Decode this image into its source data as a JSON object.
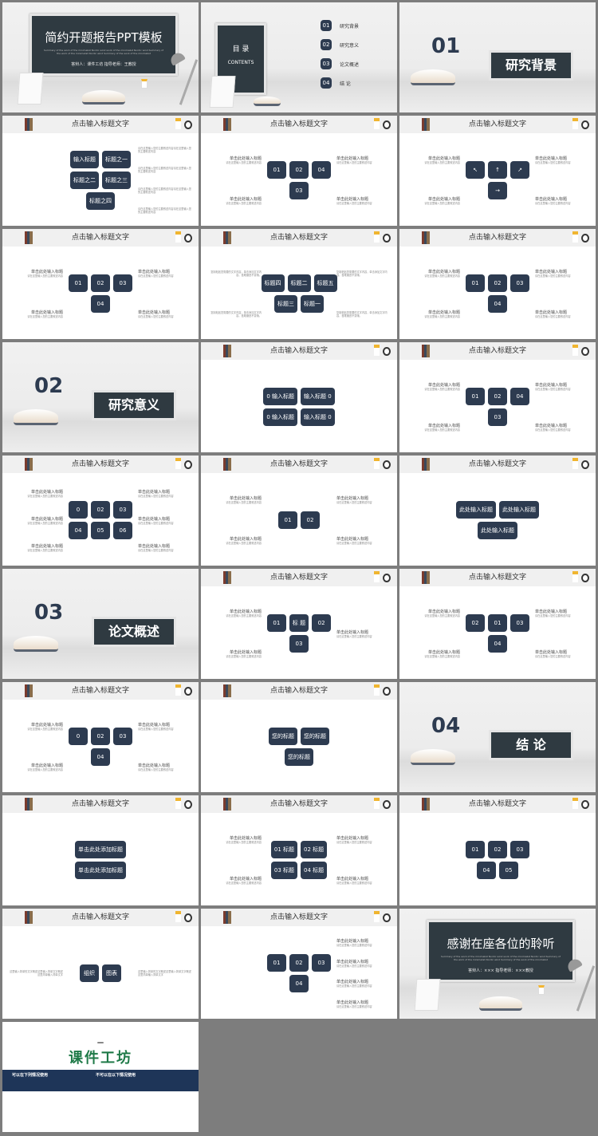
{
  "colors": {
    "navy": "#2d3b50",
    "chalkboard": "#2f3a41",
    "background": "#7d7d7d",
    "brand_green": "#1f7a48"
  },
  "slides": [
    {
      "type": "cover",
      "title": "简约开题报告PPT模板",
      "subtitle": "Summary of the work of the minimalist Nordic wind work of the minimalist Nordic wind Summary of the work of the minimalist Nordic wind Summary of the work of the minimalist",
      "presenter": "答辩人：课件工坊",
      "advisor": "指导老师：王教授"
    },
    {
      "type": "toc",
      "title": "目  录",
      "subtitle": "CONTENTS",
      "items": [
        {
          "num": "01",
          "label": "研究背景"
        },
        {
          "num": "02",
          "label": "研究意义"
        },
        {
          "num": "03",
          "label": "论文概述"
        },
        {
          "num": "04",
          "label": "结  论"
        }
      ]
    },
    {
      "type": "section",
      "num": "01",
      "title": "研究背景"
    },
    {
      "type": "content",
      "title": "点击输入标题文字",
      "shapes": [
        "输入标题",
        "标题之一",
        "标题之二",
        "标题之三",
        "标题之四"
      ],
      "left": [],
      "right": [
        {
          "h": "",
          "s": "请在这里输入您的主要叙述内容请在这里输入您的主要叙述内容"
        },
        {
          "h": "",
          "s": "请在这里输入您的主要叙述内容请在这里输入您的主要叙述内容"
        },
        {
          "h": "",
          "s": "请在这里输入您的主要叙述内容请在这里输入您的主要叙述内容"
        },
        {
          "h": "",
          "s": "请在这里输入您的主要叙述内容请在这里输入您的主要叙述内容"
        }
      ]
    },
    {
      "type": "content",
      "title": "点击输入标题文字",
      "shapes": [
        "01",
        "02",
        "04",
        "03"
      ],
      "left": [
        {
          "h": "单击此处输入标题",
          "s": "请在这里输入您的主要叙述内容"
        },
        {
          "h": "单击此处输入标题",
          "s": "请在这里输入您的主要叙述内容"
        }
      ],
      "right": [
        {
          "h": "单击此处输入标题",
          "s": "请在这里输入您的主要叙述内容"
        },
        {
          "h": "单击此处输入标题",
          "s": "请在这里输入您的主要叙述内容"
        }
      ]
    },
    {
      "type": "content",
      "title": "点击输入标题文字",
      "shapes": [
        "↖",
        "↑",
        "↗",
        "→"
      ],
      "left": [
        {
          "h": "单击此处输入标题",
          "s": "请在这里输入您的主要叙述内容"
        },
        {
          "h": "单击此处输入标题",
          "s": "请在这里输入您的主要叙述内容"
        }
      ],
      "right": [
        {
          "h": "单击此处输入标题",
          "s": "请在这里输入您的主要叙述内容"
        },
        {
          "h": "单击此处输入标题",
          "s": "请在这里输入您的主要叙述内容"
        }
      ]
    },
    {
      "type": "content",
      "title": "点击输入标题文字",
      "shapes": [
        "01",
        "02",
        "03",
        "04"
      ],
      "left": [
        {
          "h": "单击此处输入标题",
          "s": "请在这里输入您的主要叙述内容"
        },
        {
          "h": "单击此处输入标题",
          "s": "请在这里输入您的主要叙述内容"
        }
      ],
      "right": [
        {
          "h": "单击此处输入标题",
          "s": "请在这里输入您的主要叙述内容"
        },
        {
          "h": "单击此处输入标题",
          "s": "请在这里输入您的主要叙述内容"
        }
      ]
    },
    {
      "type": "content",
      "title": "点击输入标题文字",
      "shapes": [
        "标题四",
        "标题二",
        "标题五",
        "标题三",
        "标题一"
      ],
      "left": [
        {
          "h": "",
          "s": "复制粘贴您需要的文字内容，单击添加文字内容，首尾缩进不变哦。"
        },
        {
          "h": "",
          "s": "复制粘贴您需要的文字内容，单击添加文字内容，首尾缩进不变哦。"
        }
      ],
      "right": [
        {
          "h": "",
          "s": "复制粘贴您需要的文字内容，单击添加文字内容，首尾缩进不变哦。"
        },
        {
          "h": "",
          "s": "复制粘贴您需要的文字内容，单击添加文字内容，首尾缩进不变哦。"
        }
      ]
    },
    {
      "type": "content",
      "title": "点击输入标题文字",
      "shapes": [
        "01",
        "02",
        "03",
        "04"
      ],
      "left": [
        {
          "h": "单击此处输入标题",
          "s": "请在这里输入您的主要叙述内容"
        },
        {
          "h": "单击此处输入标题",
          "s": "请在这里输入您的主要叙述内容"
        }
      ],
      "right": [
        {
          "h": "单击此处输入标题",
          "s": "请在这里输入您的主要叙述内容"
        },
        {
          "h": "单击此处输入标题",
          "s": "请在这里输入您的主要叙述内容"
        }
      ]
    },
    {
      "type": "section",
      "num": "02",
      "title": "研究意义"
    },
    {
      "type": "content",
      "title": "点击输入标题文字",
      "shapes": [
        "0 输入标题",
        "输入标题 0",
        "0 输入标题",
        "输入标题 0"
      ],
      "left": [],
      "right": []
    },
    {
      "type": "content",
      "title": "点击输入标题文字",
      "shapes": [
        "01",
        "02",
        "04",
        "03"
      ],
      "left": [
        {
          "h": "单击此处输入标题",
          "s": "请在这里输入您的主要叙述内容"
        },
        {
          "h": "单击此处输入标题",
          "s": "请在这里输入您的主要叙述内容"
        }
      ],
      "right": [
        {
          "h": "单击此处输入标题",
          "s": "请在这里输入您的主要叙述内容"
        },
        {
          "h": "单击此处输入标题",
          "s": "请在这里输入您的主要叙述内容"
        }
      ]
    },
    {
      "type": "content",
      "title": "点击输入标题文字",
      "shapes": [
        "0",
        "02",
        "03",
        "04",
        "05",
        "06"
      ],
      "left": [
        {
          "h": "单击此处输入标题",
          "s": "请在这里输入您的主要叙述内容"
        },
        {
          "h": "单击此处输入标题",
          "s": "请在这里输入您的主要叙述内容"
        },
        {
          "h": "单击此处输入标题",
          "s": "请在这里输入您的主要叙述内容"
        }
      ],
      "right": [
        {
          "h": "单击此处输入标题",
          "s": "请在这里输入您的主要叙述内容"
        },
        {
          "h": "单击此处输入标题",
          "s": "请在这里输入您的主要叙述内容"
        },
        {
          "h": "单击此处输入标题",
          "s": "请在这里输入您的主要叙述内容"
        }
      ]
    },
    {
      "type": "content",
      "title": "点击输入标题文字",
      "shapes": [
        "01",
        "02"
      ],
      "left": [
        {
          "h": "单击此处输入标题",
          "s": "请在这里输入您的主要叙述内容"
        },
        {
          "h": "单击此处输入标题",
          "s": "请在这里输入您的主要叙述内容"
        }
      ],
      "right": [
        {
          "h": "单击此处输入标题",
          "s": "请在这里输入您的主要叙述内容"
        },
        {
          "h": "单击此处输入标题",
          "s": "请在这里输入您的主要叙述内容"
        }
      ]
    },
    {
      "type": "content",
      "title": "点击输入标题文字",
      "shapes": [
        "此处输入标题",
        "此处输入标题",
        "此处输入标题"
      ],
      "left": [],
      "right": []
    },
    {
      "type": "section",
      "num": "03",
      "title": "论文概述"
    },
    {
      "type": "content",
      "title": "点击输入标题文字",
      "shapes": [
        "01",
        "标 题",
        "02",
        "03"
      ],
      "left": [
        {
          "h": "单击此处输入标题",
          "s": "请在这里输入您的主要叙述内容"
        },
        {
          "h": "单击此处输入标题",
          "s": "请在这里输入您的主要叙述内容"
        }
      ],
      "right": [
        {
          "h": "单击此处输入标题",
          "s": "请在这里输入您的主要叙述内容"
        }
      ]
    },
    {
      "type": "content",
      "title": "点击输入标题文字",
      "shapes": [
        "02",
        "01",
        "03",
        "04"
      ],
      "left": [
        {
          "h": "单击此处输入标题",
          "s": "请在这里输入您的主要叙述内容"
        },
        {
          "h": "单击此处输入标题",
          "s": "请在这里输入您的主要叙述内容"
        }
      ],
      "right": [
        {
          "h": "单击此处输入标题",
          "s": "请在这里输入您的主要叙述内容"
        },
        {
          "h": "单击此处输入标题",
          "s": "请在这里输入您的主要叙述内容"
        }
      ]
    },
    {
      "type": "content",
      "title": "点击输入标题文字",
      "shapes": [
        "0",
        "02",
        "03",
        "04"
      ],
      "left": [
        {
          "h": "单击此处输入标题",
          "s": "请在这里输入您的主要叙述内容"
        },
        {
          "h": "单击此处输入标题",
          "s": "请在这里输入您的主要叙述内容"
        }
      ],
      "right": [
        {
          "h": "单击此处输入标题",
          "s": "请在这里输入您的主要叙述内容"
        },
        {
          "h": "单击此处输入标题",
          "s": "请在这里输入您的主要叙述内容"
        }
      ]
    },
    {
      "type": "content",
      "title": "点击输入标题文字",
      "shapes": [
        "您的标题",
        "您的标题",
        "您的标题"
      ],
      "left": [],
      "right": []
    },
    {
      "type": "section",
      "num": "04",
      "title": "结  论"
    },
    {
      "type": "content",
      "title": "点击输入标题文字",
      "shapes": [
        "单击此处添加标题",
        "单击此处添加标题"
      ],
      "left": [],
      "right": []
    },
    {
      "type": "content",
      "title": "点击输入标题文字",
      "shapes": [
        "01 标题",
        "02 标题",
        "03 标题",
        "04 标题"
      ],
      "left": [
        {
          "h": "单击此处输入标题",
          "s": "请在这里输入您的主要叙述内容"
        },
        {
          "h": "单击此处输入标题",
          "s": "请在这里输入您的主要叙述内容"
        }
      ],
      "right": [
        {
          "h": "单击此处输入标题",
          "s": "请在这里输入您的主要叙述内容"
        },
        {
          "h": "单击此处输入标题",
          "s": "请在这里输入您的主要叙述内容"
        }
      ]
    },
    {
      "type": "content",
      "title": "点击输入标题文字",
      "shapes": [
        "01",
        "02",
        "03",
        "04",
        "05"
      ],
      "left": [],
      "right": []
    },
    {
      "type": "content",
      "title": "点击输入标题文字",
      "shapes": [
        "组织",
        "图表"
      ],
      "left": [
        {
          "h": "",
          "s": "这里输入简单的文字概述这里输入简单文字概述这里简单输入简单文字"
        }
      ],
      "right": [
        {
          "h": "",
          "s": "这里输入简单的文字概述这里输入简单文字概述这里简单输入简单文字"
        }
      ]
    },
    {
      "type": "content",
      "title": "点击输入标题文字",
      "shapes": [
        "01",
        "02",
        "03",
        "04"
      ],
      "left": [],
      "right": [
        {
          "h": "单击此处输入标题",
          "s": "请在这里输入您的主要叙述内容"
        },
        {
          "h": "单击此处输入标题",
          "s": "请在这里输入您的主要叙述内容"
        },
        {
          "h": "单击此处输入标题",
          "s": "请在这里输入您的主要叙述内容"
        },
        {
          "h": "单击此处输入标题",
          "s": "请在这里输入您的主要叙述内容"
        }
      ]
    },
    {
      "type": "cover",
      "title": "感谢在座各位的聆听",
      "subtitle": "Summary of the work of the minimalist Nordic wind work of the minimalist Nordic wind Summary of the work of the minimalist Nordic wind Summary of the work of the minimalist",
      "presenter": "答辩人：×××",
      "advisor": "指导老师：×××教授"
    },
    {
      "type": "end",
      "brand": "课件工坊",
      "can_use": "可以在下列情况使用",
      "cannot_use": "不可以在以下情况使用"
    }
  ]
}
